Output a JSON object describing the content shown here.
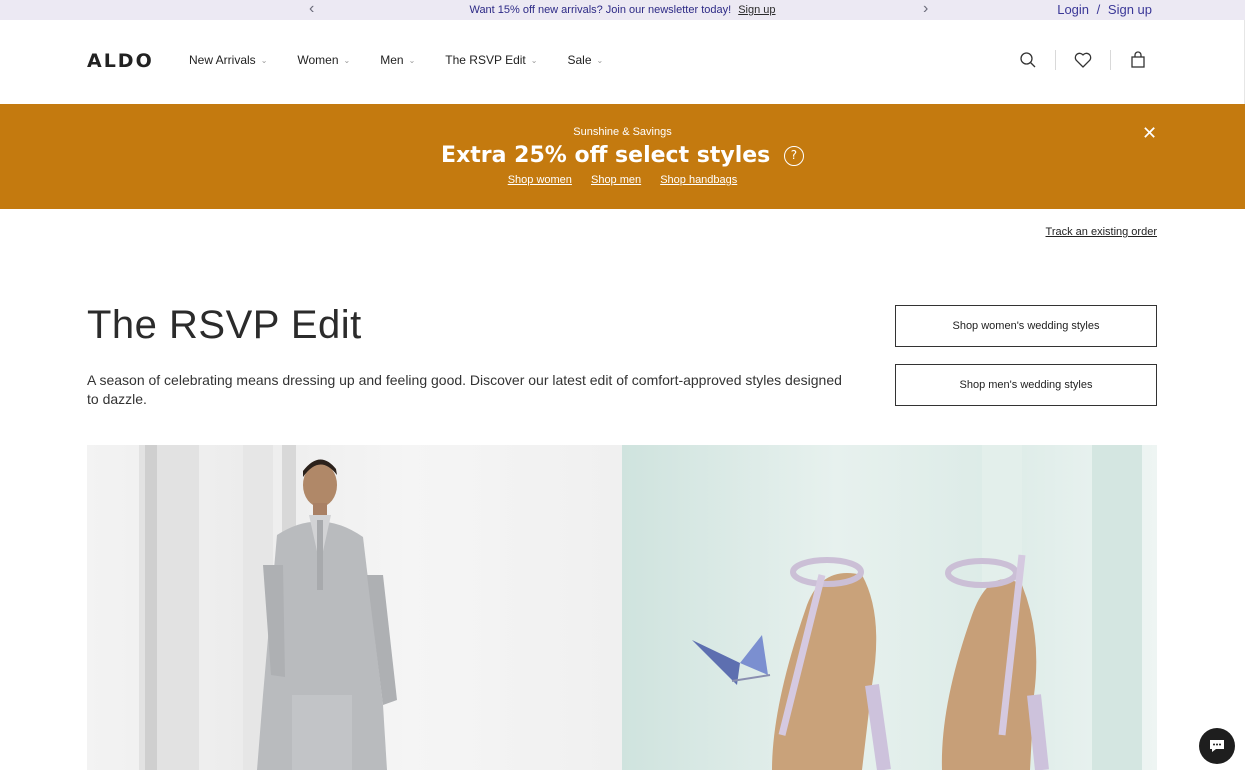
{
  "topbar": {
    "message": "Want 15% off new arrivals? Join our newsletter today!",
    "signup": "Sign up",
    "login": "Login",
    "divider": "/",
    "signup_right": "Sign up"
  },
  "header": {
    "logo": "ALDO",
    "nav": [
      {
        "label": "New Arrivals"
      },
      {
        "label": "Women"
      },
      {
        "label": "Men"
      },
      {
        "label": "The RSVP Edit"
      },
      {
        "label": "Sale"
      }
    ]
  },
  "promo": {
    "subtitle": "Sunshine & Savings",
    "headline": "Extra 25% off select styles",
    "help": "?",
    "links": [
      "Shop women",
      "Shop men",
      "Shop handbags"
    ]
  },
  "track_order": "Track an existing order",
  "hero": {
    "title": "The RSVP Edit",
    "description": "A season of celebrating means dressing up and feeling good. Discover our latest edit of comfort-approved styles designed to dazzle.",
    "buttons": [
      "Shop women's wedding styles",
      "Shop men's wedding styles"
    ]
  },
  "colors": {
    "promo_bg": "#c47a0f",
    "topbar_bg": "#ece9f3",
    "link_purple": "#3b3898"
  }
}
